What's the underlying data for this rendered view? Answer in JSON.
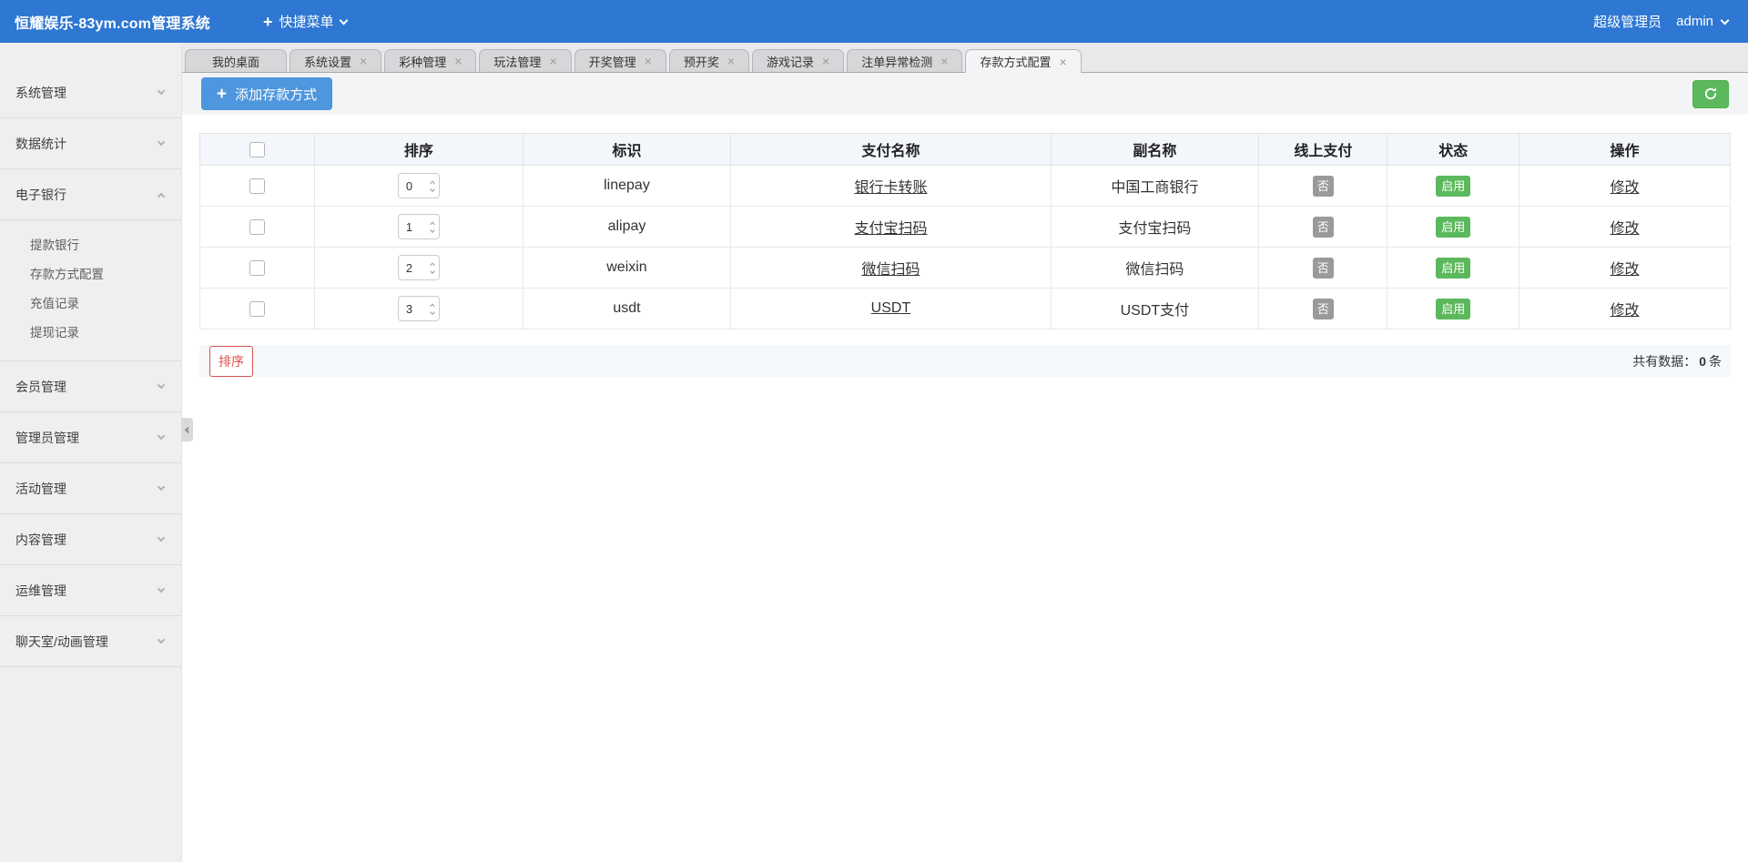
{
  "navbar": {
    "title": "恒耀娱乐-83ym.com管理系统",
    "quick_menu": "快捷菜单",
    "role": "超级管理员",
    "username": "admin"
  },
  "tabs": [
    {
      "label": "我的桌面",
      "closable": false,
      "active": false
    },
    {
      "label": "系统设置",
      "closable": true,
      "active": false
    },
    {
      "label": "彩种管理",
      "closable": true,
      "active": false
    },
    {
      "label": "玩法管理",
      "closable": true,
      "active": false
    },
    {
      "label": "开奖管理",
      "closable": true,
      "active": false
    },
    {
      "label": "预开奖",
      "closable": true,
      "active": false
    },
    {
      "label": "游戏记录",
      "closable": true,
      "active": false
    },
    {
      "label": "注单异常检测",
      "closable": true,
      "active": false
    },
    {
      "label": "存款方式配置",
      "closable": true,
      "active": true
    }
  ],
  "sidebar": {
    "groups": [
      {
        "label": "系统管理",
        "expanded": false,
        "children": []
      },
      {
        "label": "数据统计",
        "expanded": false,
        "children": []
      },
      {
        "label": "电子银行",
        "expanded": true,
        "children": [
          "提款银行",
          "存款方式配置",
          "充值记录",
          "提现记录"
        ]
      },
      {
        "label": "会员管理",
        "expanded": false,
        "children": []
      },
      {
        "label": "管理员管理",
        "expanded": false,
        "children": []
      },
      {
        "label": "活动管理",
        "expanded": false,
        "children": []
      },
      {
        "label": "内容管理",
        "expanded": false,
        "children": []
      },
      {
        "label": "运维管理",
        "expanded": false,
        "children": []
      },
      {
        "label": "聊天室/动画管理",
        "expanded": false,
        "children": []
      }
    ]
  },
  "toolbar": {
    "add_button": "添加存款方式"
  },
  "table": {
    "headers": [
      "排序",
      "标识",
      "支付名称",
      "副名称",
      "线上支付",
      "状态",
      "操作"
    ],
    "rows": [
      {
        "sort": "0",
        "code": "linepay",
        "pay_name": "银行卡转账",
        "sub_name": "中国工商银行",
        "online": "否",
        "status": "启用",
        "action": "修改"
      },
      {
        "sort": "1",
        "code": "alipay",
        "pay_name": "支付宝扫码",
        "sub_name": "支付宝扫码",
        "online": "否",
        "status": "启用",
        "action": "修改"
      },
      {
        "sort": "2",
        "code": "weixin",
        "pay_name": "微信扫码",
        "sub_name": "微信扫码",
        "online": "否",
        "status": "启用",
        "action": "修改"
      },
      {
        "sort": "3",
        "code": "usdt",
        "pay_name": "USDT",
        "sub_name": "USDT支付",
        "online": "否",
        "status": "启用",
        "action": "修改"
      }
    ]
  },
  "footer": {
    "sort_button": "排序",
    "total_label": "共有数据：",
    "total_count": "0",
    "total_unit": "条"
  },
  "colors": {
    "navbar": "#2e77d2",
    "primary_button": "#4e96dd",
    "refresh_button": "#5cb85c",
    "status_enabled_badge": "#5cb85c",
    "online_no_badge": "#9a9a9a",
    "sort_button_red": "#d9534f",
    "table_header_bg": "#f3f7fb"
  }
}
